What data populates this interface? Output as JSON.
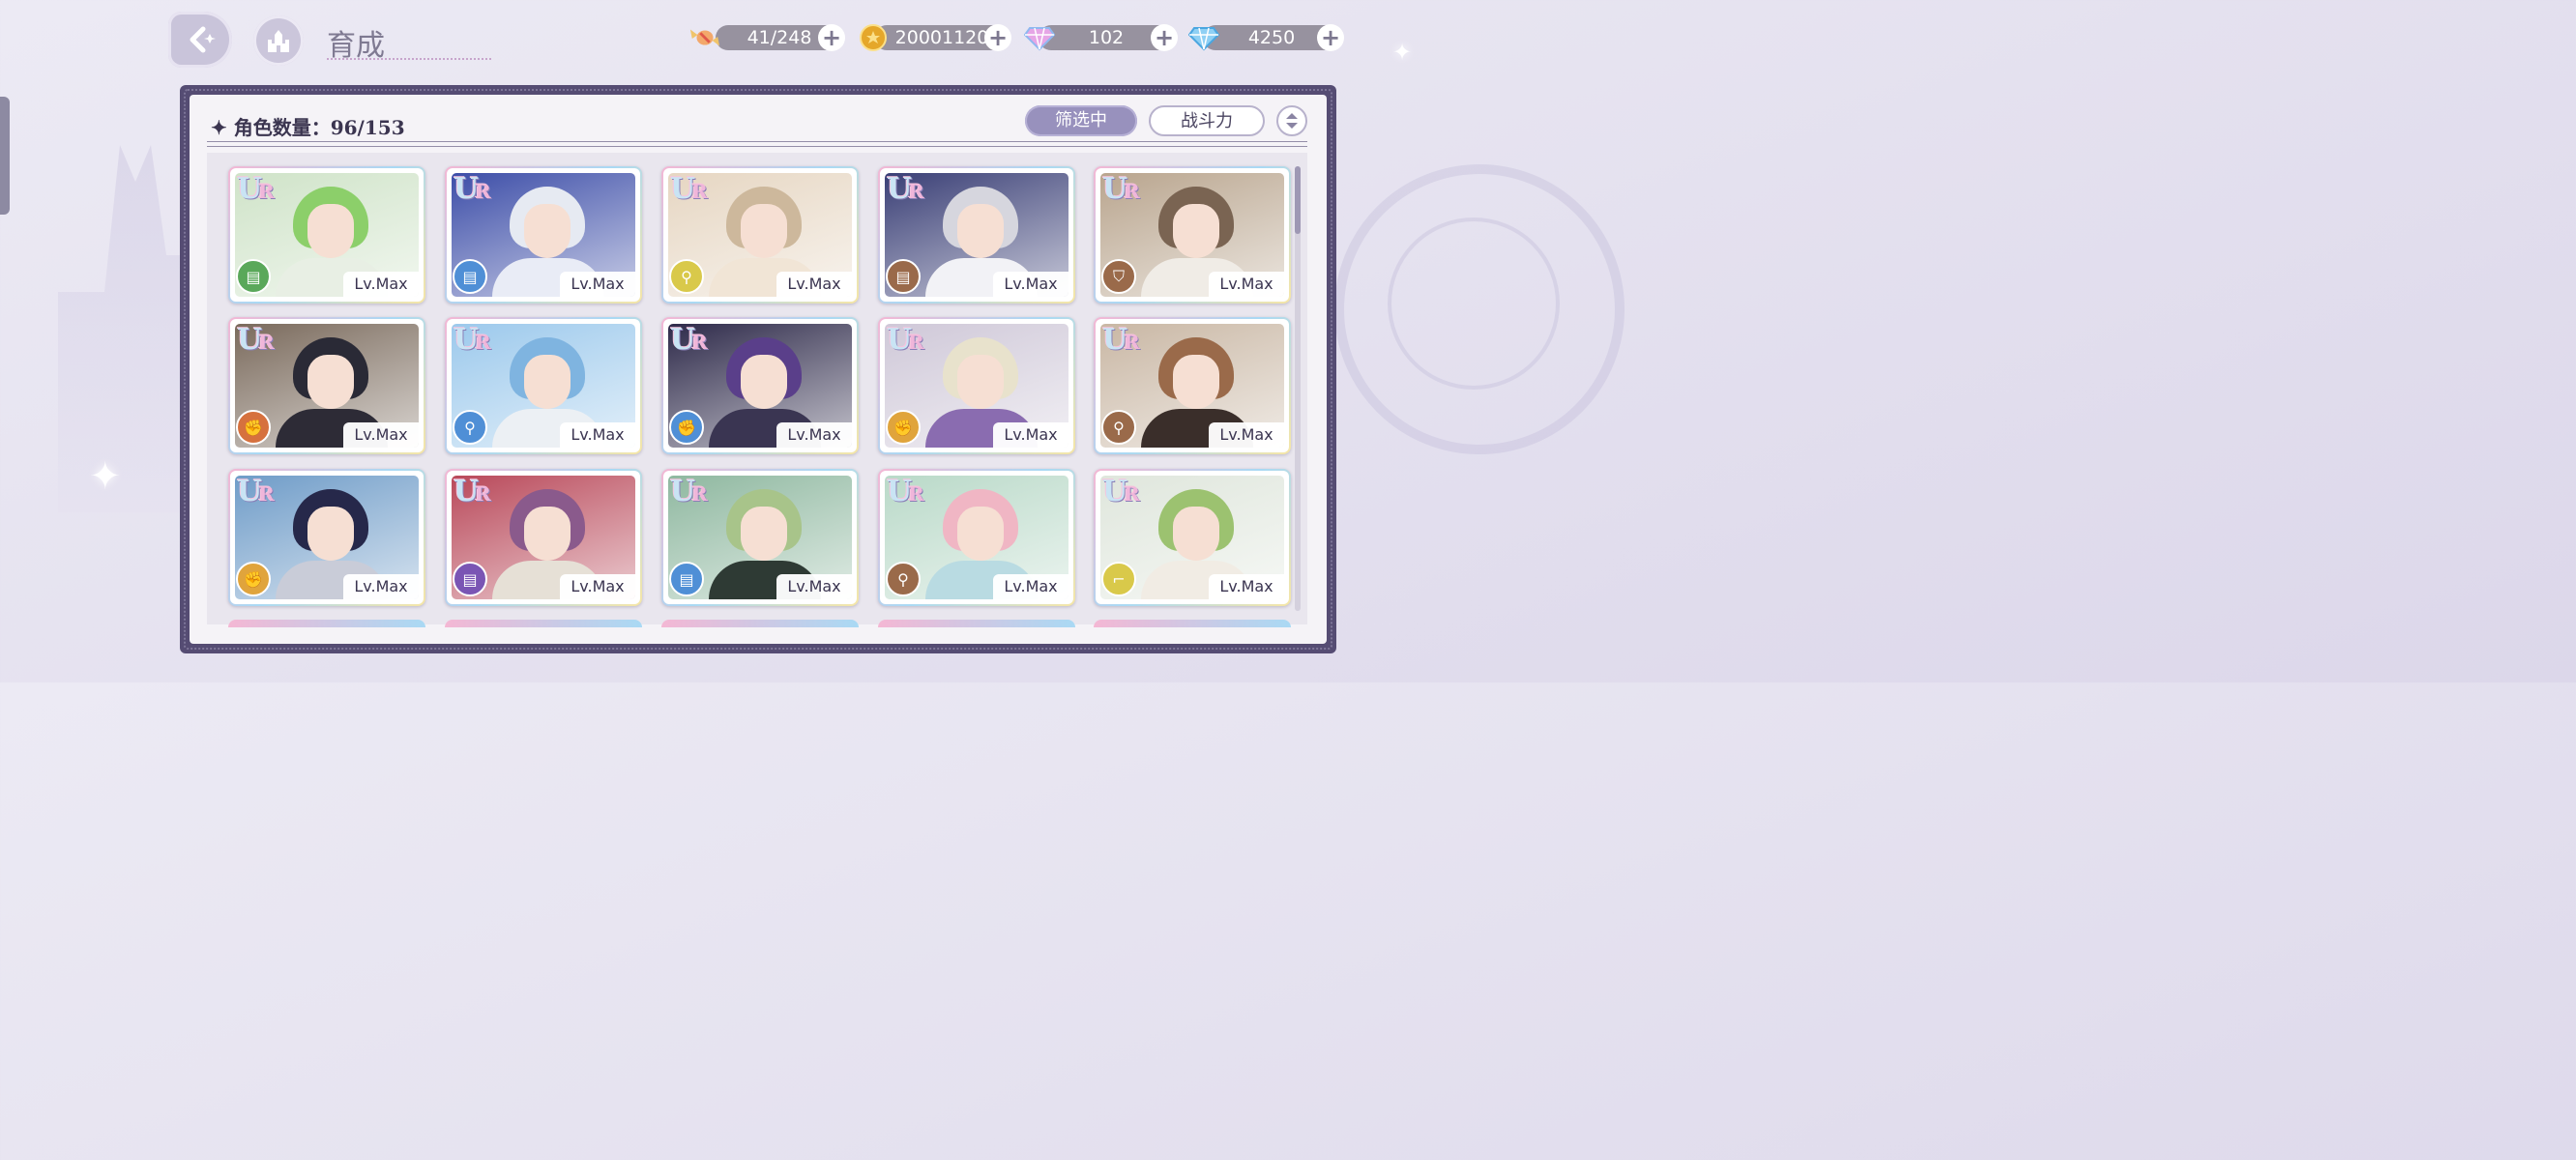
{
  "header": {
    "title": "育成",
    "resources": [
      {
        "name": "candy",
        "icon": "candy-icon",
        "value": "41/248"
      },
      {
        "name": "gold",
        "icon": "gold-coin-icon",
        "value": "20001120"
      },
      {
        "name": "rainbow-gem",
        "icon": "rainbow-diamond-icon",
        "value": "102"
      },
      {
        "name": "blue-gem",
        "icon": "blue-diamond-icon",
        "value": "4250"
      }
    ]
  },
  "panel": {
    "count_label": "✦ 角色数量：96/153",
    "filter_label": "筛选中",
    "sort_label": "战斗力"
  },
  "card_common": {
    "rarity_main": "U",
    "rarity_sub": "R",
    "level": "Lv.Max"
  },
  "cards": [
    {
      "attr_icon": "card-icon",
      "attr_color": "#5aa85a",
      "hair": "#8ccf6a",
      "bg": "#cfe3c8",
      "outfit": "#e8efe4"
    },
    {
      "attr_icon": "card-icon",
      "attr_color": "#4f8fd6",
      "hair": "#e6eaf2",
      "bg": "#3d4ea8",
      "outfit": "#e9ecf6"
    },
    {
      "attr_icon": "key-icon",
      "attr_color": "#d9c94a",
      "hair": "#cdb89c",
      "bg": "#e6d6c2",
      "outfit": "#f1e5d6"
    },
    {
      "attr_icon": "card-icon",
      "attr_color": "#9a6a4a",
      "hair": "#d6d6de",
      "bg": "#3a3f76",
      "outfit": "#f2f2f6"
    },
    {
      "attr_icon": "shield-icon",
      "attr_color": "#9a6a4a",
      "hair": "#7a6452",
      "bg": "#b9a58e",
      "outfit": "#f0ece6"
    },
    {
      "attr_icon": "fist-icon",
      "attr_color": "#d6713e",
      "hair": "#2a2a36",
      "bg": "#7a6a5c",
      "outfit": "#2d2b36"
    },
    {
      "attr_icon": "key-icon",
      "attr_color": "#4f8fd6",
      "hair": "#7fb4e0",
      "bg": "#9cc9ec",
      "outfit": "#ecf0f4"
    },
    {
      "attr_icon": "fist-icon",
      "attr_color": "#4f8fd6",
      "hair": "#5a3f8a",
      "bg": "#2e2a4a",
      "outfit": "#3a3552"
    },
    {
      "attr_icon": "fist-icon",
      "attr_color": "#e0a43c",
      "hair": "#e8e2cc",
      "bg": "#cfc8d8",
      "outfit": "#8a6cb0"
    },
    {
      "attr_icon": "key-icon",
      "attr_color": "#9a6a4a",
      "hair": "#9a6a4a",
      "bg": "#c9b7a4",
      "outfit": "#3a2e2a"
    },
    {
      "attr_icon": "fist-icon",
      "attr_color": "#e0a43c",
      "hair": "#26284a",
      "bg": "#6f9cc8",
      "outfit": "#c9ccd8"
    },
    {
      "attr_icon": "card-icon",
      "attr_color": "#7a55b4",
      "hair": "#8a5a8c",
      "bg": "#b9495a",
      "outfit": "#e6e0d6"
    },
    {
      "attr_icon": "card-icon",
      "attr_color": "#4f8fd6",
      "hair": "#a8c48a",
      "bg": "#8fb8a0",
      "outfit": "#2e3a34"
    },
    {
      "attr_icon": "key-icon",
      "attr_color": "#9a6a4a",
      "hair": "#f0b6c4",
      "bg": "#b9d9c8",
      "outfit": "#b9dbe2"
    },
    {
      "attr_icon": "boot-icon",
      "attr_color": "#d9c94a",
      "hair": "#9cc270",
      "bg": "#dfe6dc",
      "outfit": "#f1ece4"
    }
  ]
}
